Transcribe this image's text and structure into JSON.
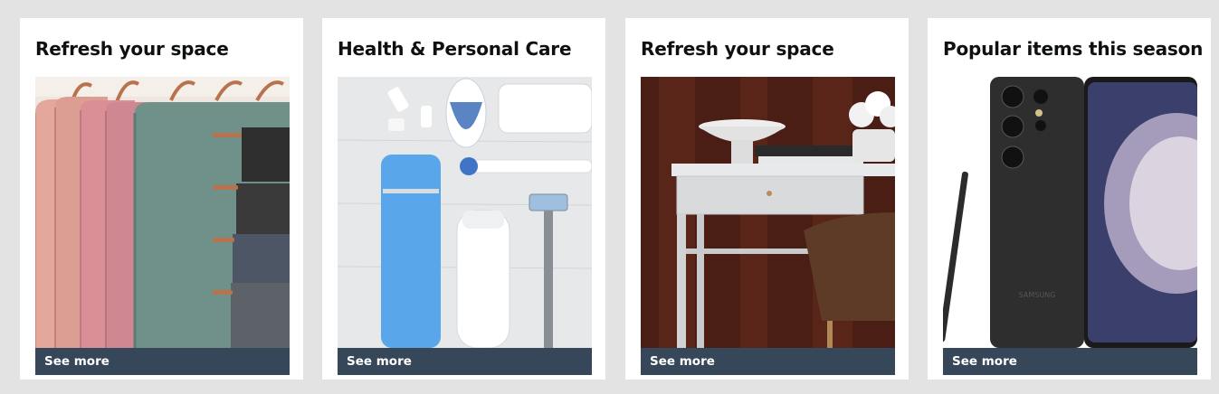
{
  "cards": [
    {
      "title": "Refresh your space",
      "image_subject": "rose and sage towels on copper hanging rack",
      "cta": "See more"
    },
    {
      "title": "Health & Personal Care",
      "image_subject": "personal care products flat lay",
      "cta": "See more"
    },
    {
      "title": "Refresh your space",
      "image_subject": "white desk with bowl, books and flowers",
      "cta": "See more"
    },
    {
      "title": "Popular items this season",
      "image_subject": "black smartphone with stylus",
      "cta": "See more",
      "brand_print": "SAMSUNG"
    }
  ],
  "colors": {
    "page_bg": "#e3e3e3",
    "card_bg": "#ffffff",
    "cta_bg": "#37475a",
    "cta_text": "#ffffff",
    "title_text": "#0f1111"
  }
}
